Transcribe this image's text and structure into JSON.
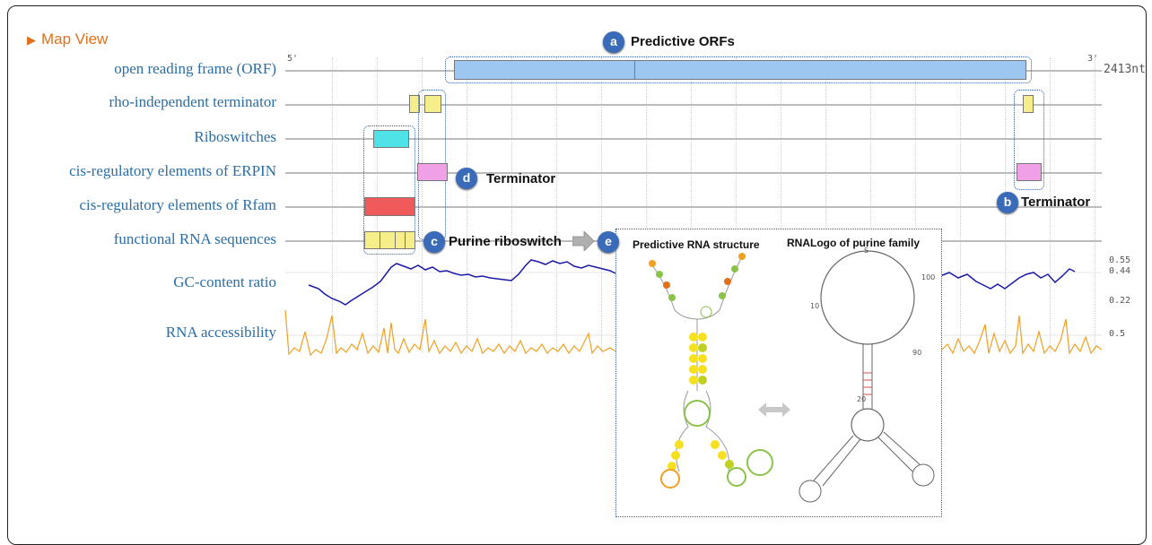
{
  "header": {
    "title": "Map View",
    "triangle": "▶"
  },
  "tracks": [
    {
      "label": "open reading frame (ORF)"
    },
    {
      "label": "rho-independent terminator"
    },
    {
      "label": "Riboswitches"
    },
    {
      "label": "cis-regulatory elements of ERPIN"
    },
    {
      "label": "cis-regulatory elements of Rfam"
    },
    {
      "label": "functional RNA sequences"
    },
    {
      "label": "GC-content ratio"
    },
    {
      "label": "RNA accessibility"
    }
  ],
  "ends": {
    "five": "5'",
    "three": "3'",
    "length": "2413nt"
  },
  "gc_ticks": [
    "0.55",
    "0.44",
    "0.22"
  ],
  "acc_tick": "0.5",
  "callouts": {
    "a": {
      "letter": "a",
      "text": "Predictive ORFs"
    },
    "b": {
      "letter": "b",
      "text": "Terminator"
    },
    "c": {
      "letter": "c",
      "text": "Purine riboswitch"
    },
    "d": {
      "letter": "d",
      "text": "Terminator"
    },
    "e": {
      "letter": "e",
      "text": "Predictive RNA structure"
    }
  },
  "inset": {
    "right_title": "RNALogo of purine family"
  },
  "colors": {
    "orf": "#9dc6f0",
    "terminator": "#f6ee8a",
    "riboswitch": "#4fe3e8",
    "erpin": "#f0a0e6",
    "rfam": "#f05a5a",
    "gc_line": "#1a1aa8",
    "access_line": "#f0a020",
    "label": "#2a6ea6",
    "badge": "#3a6bb8"
  }
}
